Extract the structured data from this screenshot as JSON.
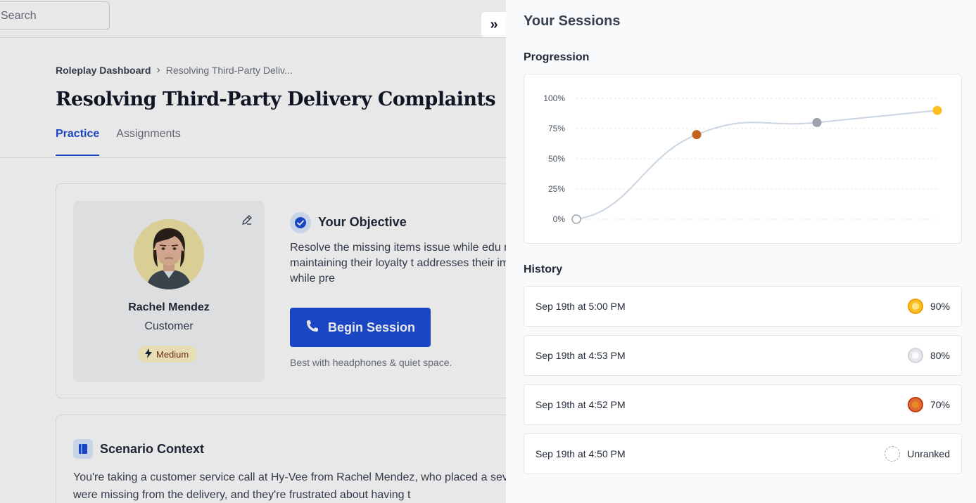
{
  "search": {
    "placeholder": "Search"
  },
  "breadcrumb": {
    "root": "Roleplay Dashboard",
    "separator": "›",
    "current": "Resolving Third-Party Deliv..."
  },
  "page_title": "Resolving Third-Party Delivery Complaints",
  "tabs": [
    {
      "label": "Practice",
      "active": true
    },
    {
      "label": "Assignments",
      "active": false
    }
  ],
  "persona": {
    "name": "Rachel Mendez",
    "role": "Customer",
    "difficulty": "Medium"
  },
  "objective": {
    "title": "Your Objective",
    "text": "Resolve the missing items issue while edu relationship and maintaining their loyalty t addresses their immediate need while pre"
  },
  "begin_session": {
    "label": "Begin Session",
    "hint": "Best with headphones & quiet space."
  },
  "scenario": {
    "title": "Scenario Context",
    "text": "You're taking a customer service call at Hy-Vee from Rachel Mendez, who placed a several items were missing from the delivery, and they're frustrated about having t"
  },
  "collapse_button": "»",
  "panel": {
    "title": "Your Sessions",
    "progression_label": "Progression",
    "history_label": "History",
    "history": [
      {
        "date": "Sep 19th at 5:00 PM",
        "score": "90%",
        "medal": "gold"
      },
      {
        "date": "Sep 19th at 4:53 PM",
        "score": "80%",
        "medal": "silver"
      },
      {
        "date": "Sep 19th at 4:52 PM",
        "score": "70%",
        "medal": "bronze"
      },
      {
        "date": "Sep 19th at 4:50 PM",
        "score": "Unranked",
        "medal": "unranked"
      }
    ]
  },
  "chart_data": {
    "type": "line",
    "title": "",
    "xlabel": "",
    "ylabel": "",
    "ylim": [
      0,
      100
    ],
    "y_ticks": [
      "0%",
      "25%",
      "50%",
      "75%",
      "100%"
    ],
    "grid": true,
    "series": [
      {
        "values": [
          0,
          70,
          80,
          90
        ],
        "point_colors": [
          "#ffffff",
          "#c2621f",
          "#9ca3af",
          "#fbbf24"
        ]
      }
    ],
    "line_color": "#cbd5e1"
  }
}
